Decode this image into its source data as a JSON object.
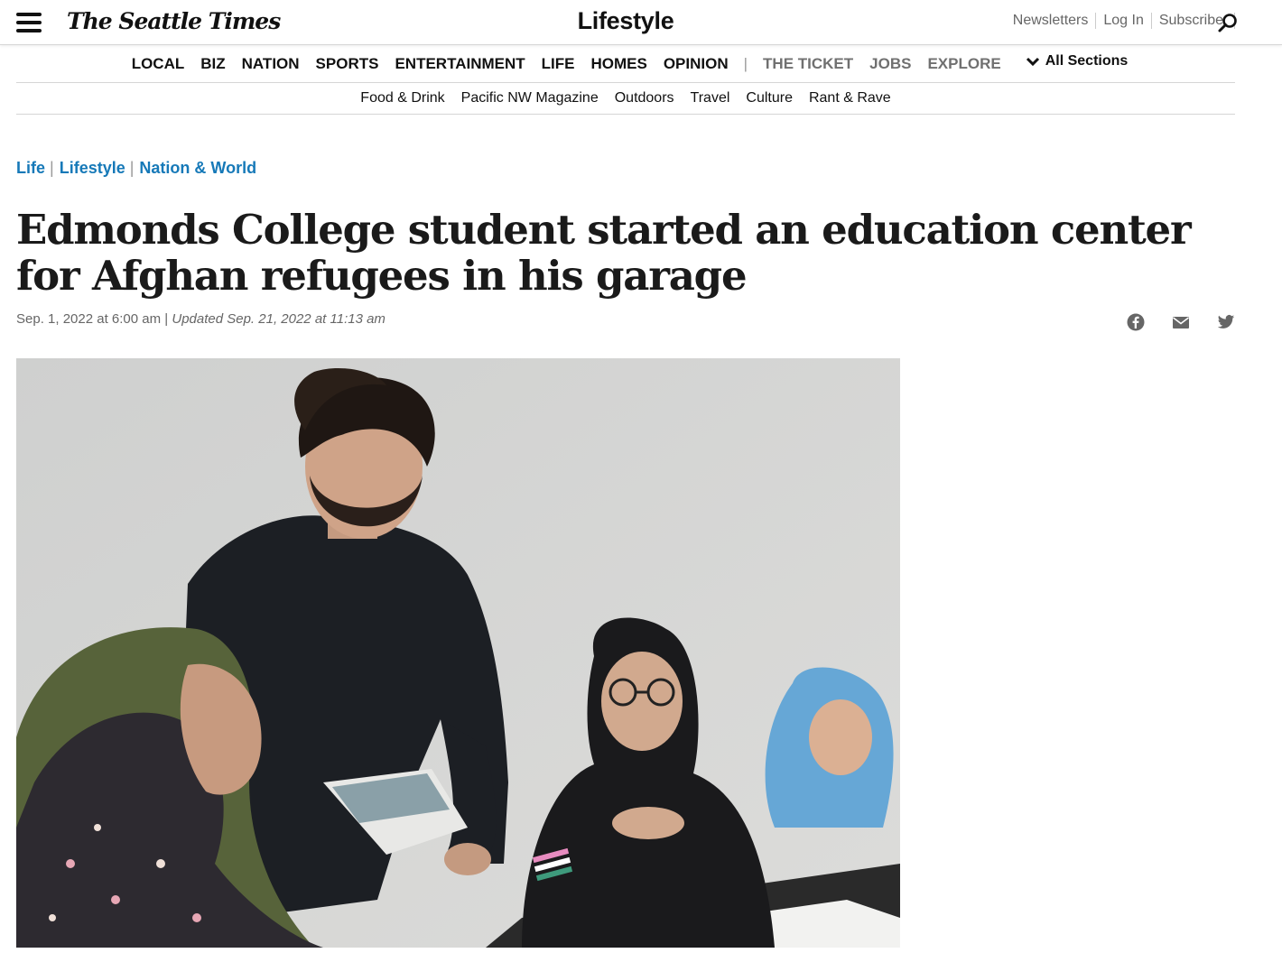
{
  "header": {
    "logo_text": "The Seattle Times",
    "section_title": "Lifestyle",
    "util_links": [
      "Newsletters",
      "Log In",
      "Subscribe"
    ]
  },
  "primary_nav": {
    "items": [
      "LOCAL",
      "BIZ",
      "NATION",
      "SPORTS",
      "ENTERTAINMENT",
      "LIFE",
      "HOMES",
      "OPINION"
    ],
    "separator": "|",
    "muted_items": [
      "THE TICKET",
      "JOBS",
      "EXPLORE"
    ],
    "all_sections": "All Sections"
  },
  "secondary_nav": {
    "items": [
      "Food & Drink",
      "Pacific NW Magazine",
      "Outdoors",
      "Travel",
      "Culture",
      "Rant & Rave"
    ]
  },
  "breadcrumb": [
    "Life",
    "Lifestyle",
    "Nation & World"
  ],
  "article": {
    "headline": "Edmonds College student started an education center for Afghan refugees in his garage",
    "published": "Sep. 1, 2022 at 6:00 am",
    "date_separator": " | ",
    "updated": "Updated Sep. 21, 2022 at 11:13 am"
  },
  "share_icons": [
    "facebook-icon",
    "email-icon",
    "twitter-icon"
  ],
  "colors": {
    "link_blue": "#1679b8",
    "muted_nav": "#707070",
    "text": "#1a1a1a"
  }
}
